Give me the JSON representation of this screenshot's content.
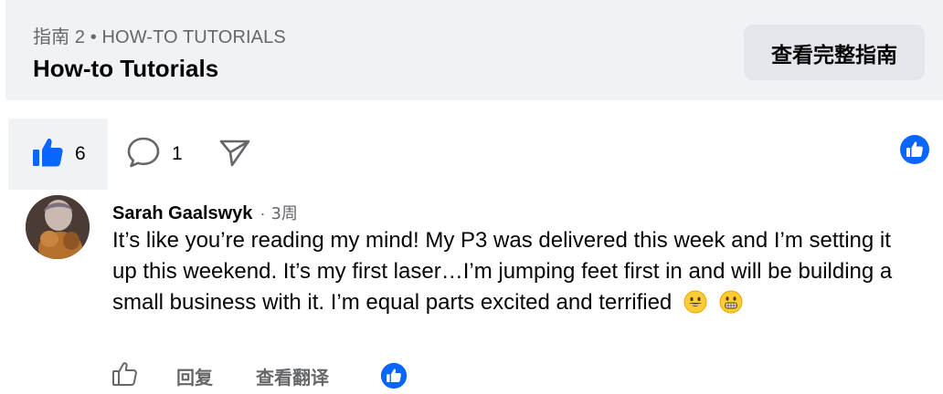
{
  "guide": {
    "meta": "指南 2 • HOW-TO TUTORIALS",
    "title": "How-to Tutorials",
    "button_label": "查看完整指南"
  },
  "reactions": {
    "like_count": "6",
    "comment_count": "1",
    "accent_color": "#0866ff",
    "icons": [
      "thumbs-up-filled-icon",
      "comment-bubble-icon",
      "share-arrow-icon",
      "like-badge-icon"
    ]
  },
  "comment": {
    "author": "Sarah Gaalswyk",
    "separator": "·",
    "time": "3周",
    "text": "It’s like you’re reading my mind! My P3 was delivered this week and I’m setting it up this weekend. It’s my first laser…I’m jumping feet first in and will be building a small business with it. I’m equal parts excited and terrified",
    "emojis": [
      "grinning-face-icon",
      "grimacing-face-icon"
    ],
    "actions": {
      "reply": "回复",
      "translate": "查看翻译"
    }
  }
}
